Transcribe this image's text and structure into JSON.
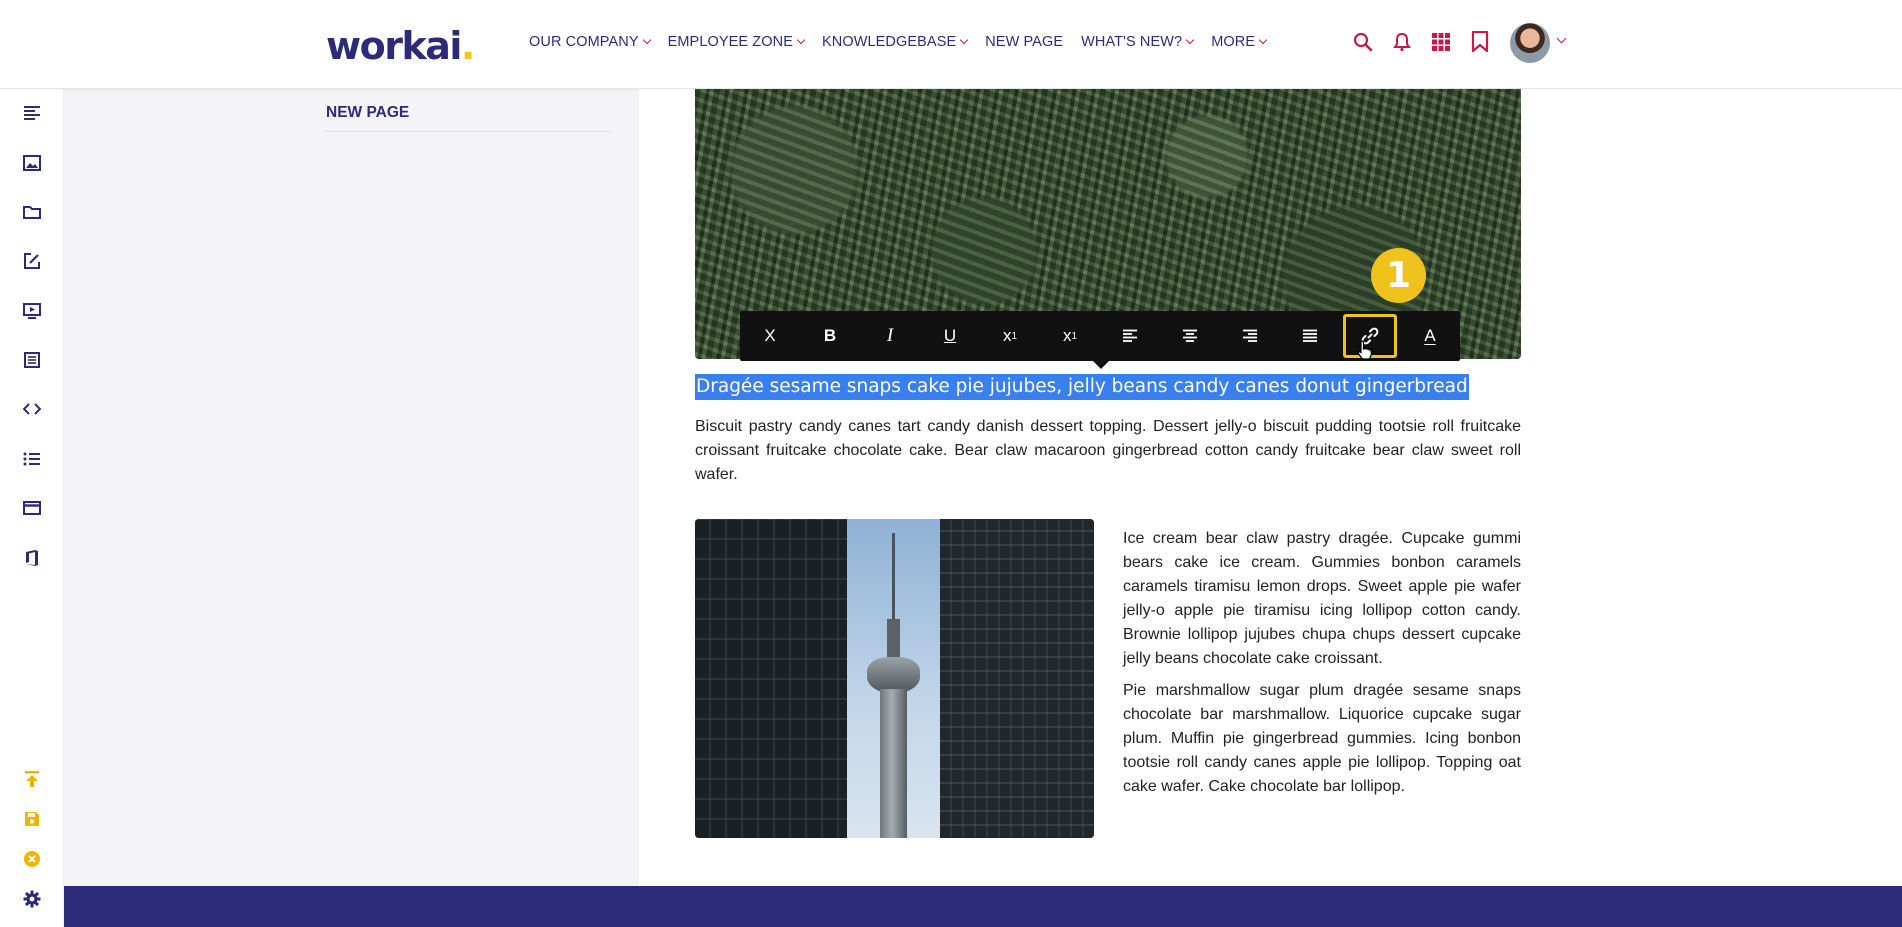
{
  "brand": {
    "name": "workai",
    "dot": "."
  },
  "nav": [
    {
      "label": "OUR COMPANY",
      "has_menu": true
    },
    {
      "label": "EMPLOYEE ZONE",
      "has_menu": true
    },
    {
      "label": "KNOWLEDGEBASE",
      "has_menu": true
    },
    {
      "label": "NEW PAGE",
      "has_menu": false
    },
    {
      "label": "WHAT'S NEW?",
      "has_menu": true
    },
    {
      "label": "MORE",
      "has_menu": true
    }
  ],
  "header_icons": [
    "search-icon",
    "bell-icon",
    "apps-grid-icon",
    "bookmark-icon"
  ],
  "rail_icons_top": [
    "text-align-icon",
    "image-icon",
    "folder-icon",
    "edit-icon",
    "video-icon",
    "form-list-icon",
    "code-icon",
    "bullet-list-icon",
    "window-icon",
    "office-icon"
  ],
  "rail_icons_bottom": [
    "publish-upload-icon",
    "save-icon",
    "cancel-icon",
    "settings-gear-icon"
  ],
  "sidebar": {
    "title": "NEW PAGE"
  },
  "toolbar": {
    "buttons": [
      {
        "label": "X",
        "name": "clear-format-button"
      },
      {
        "label": "B",
        "name": "bold-button"
      },
      {
        "label": "I",
        "name": "italic-button"
      },
      {
        "label": "U",
        "name": "underline-button"
      },
      {
        "label": "x",
        "sup": "1",
        "name": "superscript-button"
      },
      {
        "label": "x",
        "sub": "1",
        "name": "subscript-button"
      },
      {
        "name": "align-left-button"
      },
      {
        "name": "align-center-button"
      },
      {
        "name": "align-right-button"
      },
      {
        "name": "justify-button"
      },
      {
        "name": "link-button",
        "active": true
      },
      {
        "label": "A",
        "name": "text-color-button"
      }
    ]
  },
  "step_badge": "1",
  "content": {
    "heading": "Dragée sesame snaps cake pie jujubes, jelly beans candy canes donut gingerbread",
    "paragraph_1": "Biscuit pastry candy canes tart candy danish dessert topping. Dessert jelly-o biscuit pudding tootsie roll fruitcake croissant fruitcake chocolate cake. Bear claw macaroon gingerbread cotton candy fruitcake bear claw sweet roll wafer.",
    "paragraph_2": "Ice cream bear claw pastry dragée. Cupcake gummi bears cake ice cream. Gummies bonbon caramels caramels tiramisu lemon drops. Sweet apple pie wafer jelly-o apple pie tiramisu icing lollipop cotton candy. Brownie lollipop jujubes chupa chups dessert cupcake jelly beans chocolate cake croissant.",
    "paragraph_3": "Pie marshmallow sugar plum dragée sesame snaps chocolate bar marshmallow. Liquorice cupcake sugar plum. Muffin pie gingerbread gummies. Icing bonbon tootsie roll candy canes apple pie lollipop. Topping oat cake wafer. Cake chocolate bar lollipop."
  },
  "colors": {
    "brand": "#2e2a7a",
    "accent": "#c8174f",
    "highlight": "#3a7ff0",
    "badge": "#f0c21c"
  }
}
